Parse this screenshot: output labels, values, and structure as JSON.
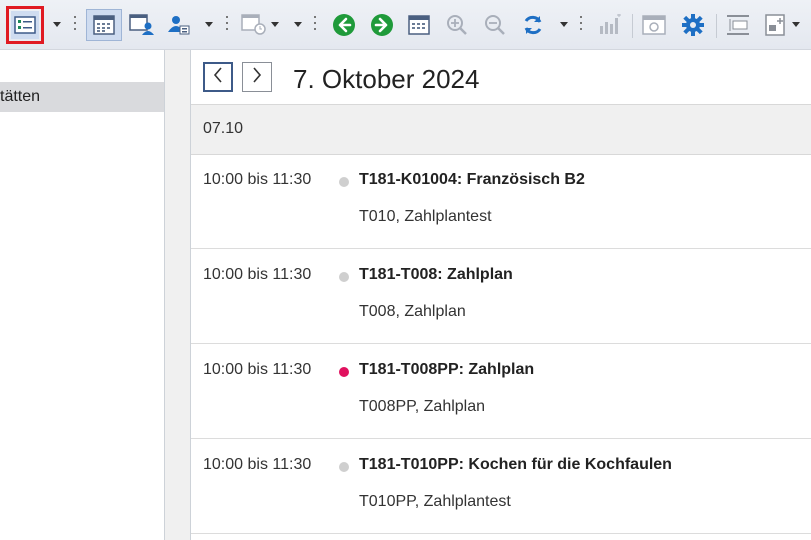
{
  "toolbar": {
    "icons": [
      "list-view-icon",
      "month-grid-icon",
      "calendar-person-icon",
      "person-group-icon",
      "calendar-clock-icon",
      "back-arrow-icon",
      "forward-arrow-icon",
      "calendar-grid-icon",
      "zoom-in-icon",
      "zoom-out-icon",
      "refresh-icon",
      "bar-chart-icon",
      "schedule-icon",
      "gear-icon",
      "align-top-icon",
      "insert-icon"
    ],
    "colors": {
      "highlight": "#e01a22",
      "green": "#1f9a3a",
      "blue": "#1e6fc4"
    }
  },
  "left_panel": {
    "selected_item": "tätten"
  },
  "main": {
    "date_title": "7. Oktober 2024",
    "day_header": "07.10",
    "events": [
      {
        "time": "10:00 bis 11:30",
        "title": "T181-K01004: Französisch B2",
        "subtitle": "T010, Zahlplantest",
        "dot_color": "#cfcfcf"
      },
      {
        "time": "10:00 bis 11:30",
        "title": "T181-T008: Zahlplan",
        "subtitle": "T008, Zahlplan",
        "dot_color": "#cfcfcf"
      },
      {
        "time": "10:00 bis 11:30",
        "title": "T181-T008PP: Zahlplan",
        "subtitle": "T008PP, Zahlplan",
        "dot_color": "#e0115f"
      },
      {
        "time": "10:00 bis 11:30",
        "title": "T181-T010PP: Kochen für die Kochfaulen",
        "subtitle": "T010PP, Zahlplantest",
        "dot_color": "#cfcfcf"
      }
    ]
  }
}
